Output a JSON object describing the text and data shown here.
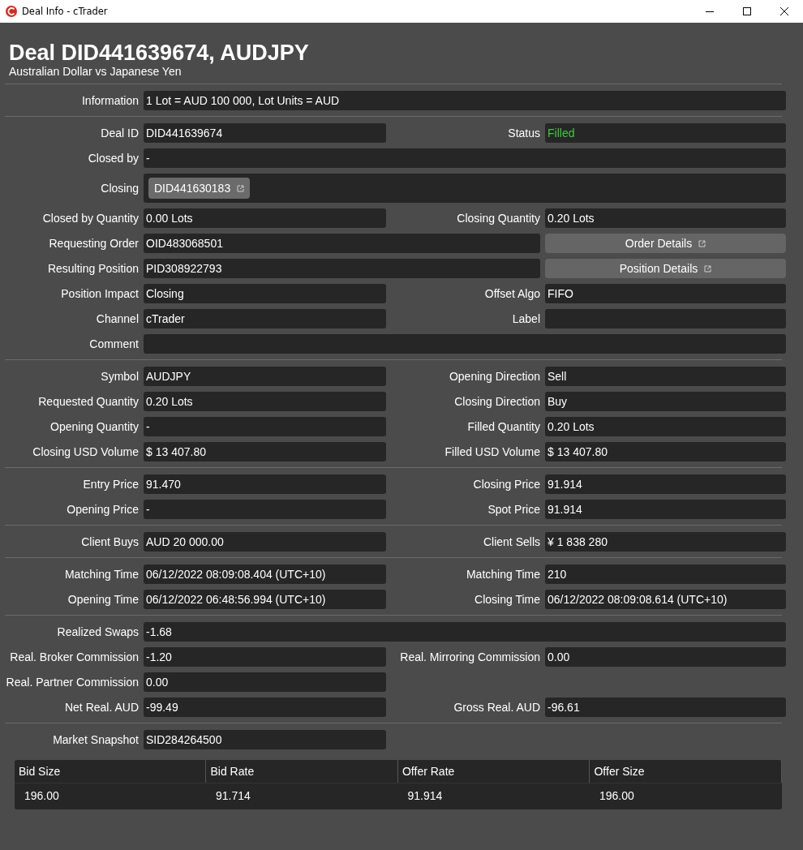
{
  "window": {
    "title": "Deal Info - cTrader"
  },
  "header": {
    "title": "Deal DID441639674, AUDJPY",
    "subtitle": "Australian Dollar vs Japanese Yen"
  },
  "sections": [
    {
      "rows": [
        {
          "kind": "full",
          "cells": [
            {
              "label": "Information",
              "value": "1 Lot = AUD 100 000, Lot Units = AUD",
              "kind": "text"
            }
          ]
        }
      ]
    },
    {
      "rows": [
        {
          "kind": "pair",
          "cells": [
            {
              "label": "Deal ID",
              "value": "DID441639674",
              "kind": "text"
            },
            {
              "label": "Status",
              "value": "Filled",
              "kind": "status"
            }
          ]
        },
        {
          "kind": "full",
          "cells": [
            {
              "label": "Closed by",
              "value": "-",
              "kind": "text"
            }
          ]
        },
        {
          "kind": "full",
          "cells": [
            {
              "label": "Closing",
              "value": "DID441630183",
              "kind": "chip"
            }
          ]
        },
        {
          "kind": "pair",
          "cells": [
            {
              "label": "Closed by Quantity",
              "value": "0.00 Lots",
              "kind": "text"
            },
            {
              "label": "Closing Quantity",
              "value": "0.20 Lots",
              "kind": "text"
            }
          ]
        },
        {
          "kind": "field-button",
          "cells": [
            {
              "label": "Requesting Order",
              "value": "OID483068501",
              "kind": "text"
            },
            {
              "value": "Order Details",
              "kind": "button"
            }
          ]
        },
        {
          "kind": "field-button",
          "cells": [
            {
              "label": "Resulting Position",
              "value": "PID308922793",
              "kind": "text"
            },
            {
              "value": "Position Details",
              "kind": "button"
            }
          ]
        },
        {
          "kind": "pair",
          "cells": [
            {
              "label": "Position Impact",
              "value": "Closing",
              "kind": "text"
            },
            {
              "label": "Offset Algo",
              "value": "FIFO",
              "kind": "text"
            }
          ]
        },
        {
          "kind": "pair",
          "cells": [
            {
              "label": "Channel",
              "value": "cTrader",
              "kind": "text"
            },
            {
              "label": "Label",
              "kind": "text"
            }
          ]
        },
        {
          "kind": "full",
          "cells": [
            {
              "label": "Comment",
              "kind": "text"
            }
          ]
        }
      ]
    },
    {
      "rows": [
        {
          "kind": "pair",
          "cells": [
            {
              "label": "Symbol",
              "value": "AUDJPY",
              "kind": "text"
            },
            {
              "label": "Opening Direction",
              "value": "Sell",
              "kind": "text"
            }
          ]
        },
        {
          "kind": "pair",
          "cells": [
            {
              "label": "Requested Quantity",
              "value": "0.20 Lots",
              "kind": "text"
            },
            {
              "label": "Closing Direction",
              "value": "Buy",
              "kind": "text"
            }
          ]
        },
        {
          "kind": "pair",
          "cells": [
            {
              "label": "Opening Quantity",
              "value": "-",
              "kind": "text"
            },
            {
              "label": "Filled Quantity",
              "value": "0.20 Lots",
              "kind": "text"
            }
          ]
        },
        {
          "kind": "pair",
          "cells": [
            {
              "label": "Closing USD Volume",
              "value": "$ 13 407.80",
              "kind": "text"
            },
            {
              "label": "Filled USD Volume",
              "value": "$ 13 407.80",
              "kind": "text"
            }
          ]
        }
      ]
    },
    {
      "rows": [
        {
          "kind": "pair",
          "cells": [
            {
              "label": "Entry Price",
              "value": "91.470",
              "kind": "text"
            },
            {
              "label": "Closing Price",
              "value": "91.914",
              "kind": "text"
            }
          ]
        },
        {
          "kind": "pair",
          "cells": [
            {
              "label": "Opening Price",
              "value": "-",
              "kind": "text"
            },
            {
              "label": "Spot Price",
              "value": "91.914",
              "kind": "text"
            }
          ]
        }
      ]
    },
    {
      "rows": [
        {
          "kind": "pair",
          "cells": [
            {
              "label": "Client Buys",
              "value": "AUD 20 000.00",
              "kind": "text"
            },
            {
              "label": "Client Sells",
              "value": "¥ 1 838 280",
              "kind": "text"
            }
          ]
        }
      ]
    },
    {
      "rows": [
        {
          "kind": "pair",
          "cells": [
            {
              "label": "Matching Time",
              "value": "06/12/2022 08:09:08.404 (UTC+10)",
              "kind": "text"
            },
            {
              "label": "Matching Time",
              "value": "210",
              "kind": "text"
            }
          ]
        },
        {
          "kind": "pair",
          "cells": [
            {
              "label": "Opening Time",
              "value": "06/12/2022 06:48:56.994 (UTC+10)",
              "kind": "text"
            },
            {
              "label": "Closing Time",
              "value": "06/12/2022 08:09:08.614 (UTC+10)",
              "kind": "text"
            }
          ]
        }
      ]
    },
    {
      "rows": [
        {
          "kind": "full",
          "cells": [
            {
              "label": "Realized Swaps",
              "value": "-1.68",
              "kind": "text"
            }
          ]
        },
        {
          "kind": "pair",
          "cells": [
            {
              "label": "Real. Broker Commission",
              "value": "-1.20",
              "kind": "text"
            },
            {
              "label": "Real. Mirroring Commission",
              "value": "0.00",
              "kind": "text"
            }
          ]
        },
        {
          "kind": "half",
          "cells": [
            {
              "label": "Real. Partner Commission",
              "value": "0.00",
              "kind": "text"
            }
          ]
        },
        {
          "kind": "pair",
          "cells": [
            {
              "label": "Net Real. AUD",
              "value": "-99.49",
              "kind": "text"
            },
            {
              "label": "Gross Real. AUD",
              "value": "-96.61",
              "kind": "text"
            }
          ]
        }
      ]
    },
    {
      "rows": [
        {
          "kind": "half",
          "cells": [
            {
              "label": "Market Snapshot",
              "value": "SID284264500",
              "kind": "text"
            }
          ]
        }
      ]
    }
  ],
  "snapshot": {
    "columns": [
      "Bid Size",
      "Bid Rate",
      "Offer Rate",
      "Offer Size"
    ],
    "rows": [
      [
        "196.00",
        "91.714",
        "91.914",
        "196.00"
      ]
    ]
  }
}
